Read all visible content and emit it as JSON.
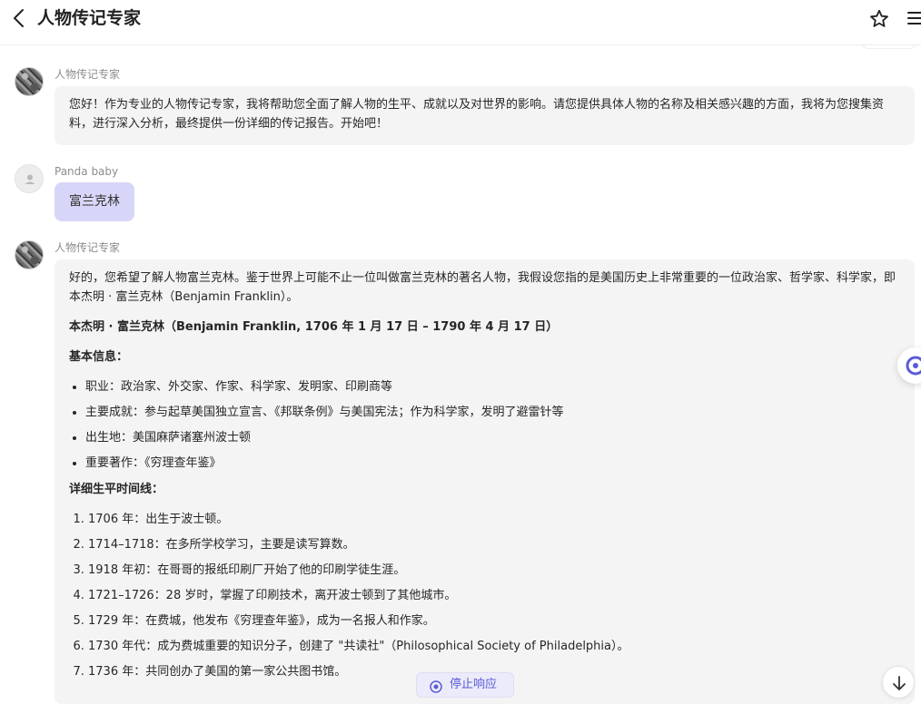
{
  "header": {
    "title": "人物传记专家"
  },
  "messages": {
    "bot1": {
      "sender": "人物传记专家",
      "text": "您好！作为专业的人物传记专家，我将帮助您全面了解人物的生平、成就以及对世界的影响。请您提供具体人物的名称及相关感兴趣的方面，我将为您搜集资料，进行深入分析，最终提供一份详细的传记报告。开始吧！"
    },
    "user1": {
      "sender": "Panda baby",
      "text": "富兰克林"
    },
    "bot2": {
      "sender": "人物传记专家",
      "intro": "好的，您希望了解人物富兰克林。鉴于世界上可能不止一位叫做富兰克林的著名人物，我假设您指的是美国历史上非常重要的一位政治家、哲学家、科学家，即本杰明 · 富兰克林（Benjamin Franklin）。",
      "heading": "本杰明 · 富兰克林（Benjamin Franklin, 1706 年 1 月 17 日 – 1790 年 4 月 17 日）",
      "basic_title": "基本信息：",
      "basic_items": [
        "职业：政治家、外交家、作家、科学家、发明家、印刷商等",
        "主要成就：参与起草美国独立宣言、《邦联条例》与美国宪法；作为科学家，发明了避雷针等",
        "出生地：美国麻萨诸塞州波士顿",
        "重要著作：《穷理查年鉴》"
      ],
      "timeline_title": "详细生平时间线：",
      "timeline_items": [
        "1706 年：出生于波士顿。",
        "1714–1718：在多所学校学习，主要是读写算数。",
        "1918 年初：在哥哥的报纸印刷厂开始了他的印刷学徒生涯。",
        "1721–1726：28 岁时，掌握了印刷技术，离开波士顿到了其他城市。",
        "1729 年：在费城，他发布《穷理查年鉴》，成为一名报人和作家。",
        "1730 年代：成为费城重要的知识分子，创建了 \"共读社\"（Philosophical Society of Philadelphia）。",
        "1736 年：共同创办了美国的第一家公共图书馆。"
      ]
    }
  },
  "controls": {
    "stop_label": "停止响应"
  },
  "icons": {
    "back": "chevron-left-icon",
    "star": "star-icon",
    "menu": "menu-icon",
    "stop": "stop-circle-icon",
    "scroll_down": "arrow-down-icon"
  },
  "colors": {
    "accent": "#5b5bd6",
    "user_bubble": "#d7d6f8",
    "bot_bubble": "#f4f4f4"
  }
}
